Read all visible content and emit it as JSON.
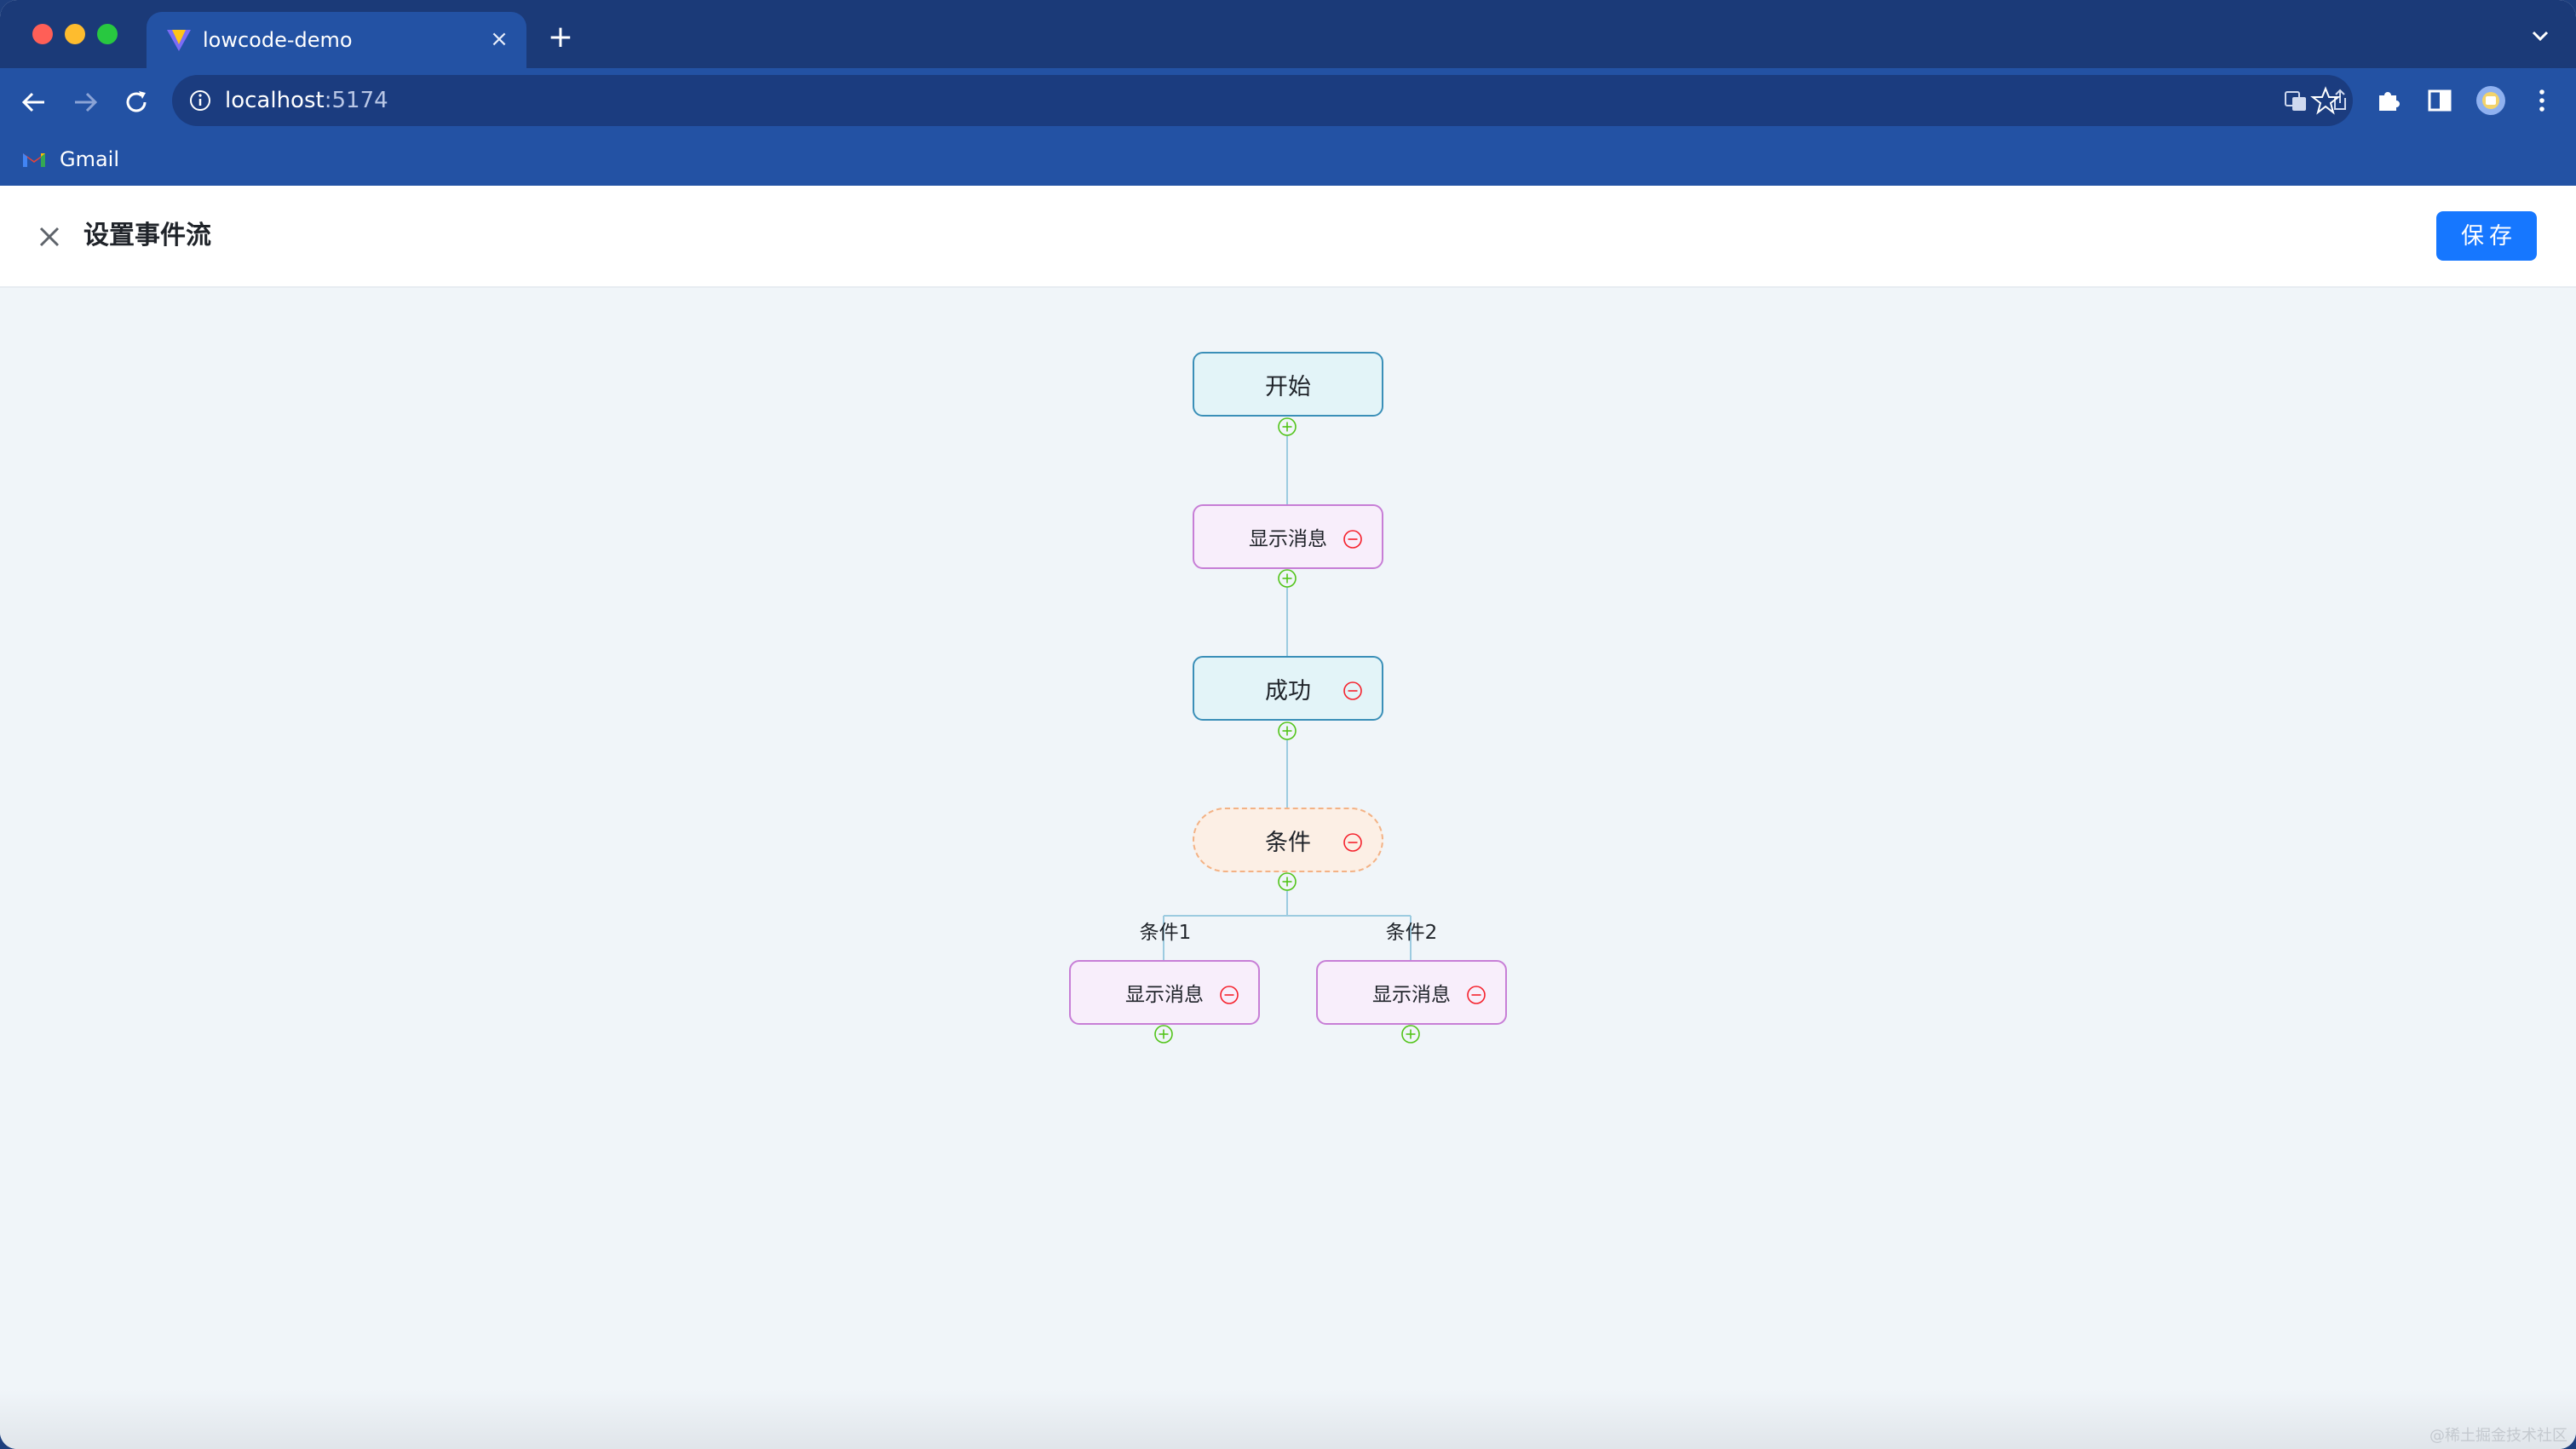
{
  "browser": {
    "tab_title": "lowcode-demo",
    "tab_close_glyph": "×",
    "new_tab_glyph": "+",
    "url_host": "localhost",
    "url_port": ":5174",
    "bookmark_gmail": "Gmail"
  },
  "header": {
    "title": "设置事件流",
    "save_label": "保存"
  },
  "flow": {
    "start": "开始",
    "show_message_1": "显示消息",
    "success": "成功",
    "condition": "条件",
    "branch_1_label": "条件1",
    "branch_2_label": "条件2",
    "branch_1_action": "显示消息",
    "branch_2_action": "显示消息"
  },
  "watermark": "@稀土掘金技术社区",
  "colors": {
    "primary": "#1677ff",
    "node_blue_border": "#3a8fb8",
    "node_purple_border": "#c77ed6",
    "node_orange_border": "#f3b285",
    "add_icon": "#52c41a",
    "remove_icon": "#f5222d",
    "edge": "#9ccbe0"
  },
  "icons": {
    "close": "close-icon",
    "add": "plus-circle-icon",
    "remove": "minus-circle-icon"
  }
}
